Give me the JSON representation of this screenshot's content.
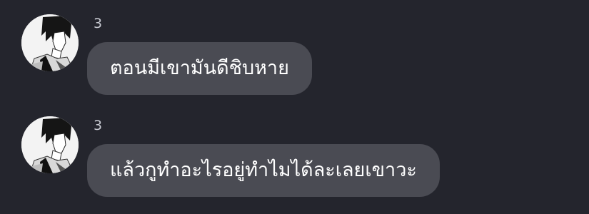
{
  "messages": [
    {
      "sender": "3",
      "text": "ตอนมีเขามันดีชิบหาย",
      "avatar_icon": "user-avatar-icon"
    },
    {
      "sender": "3",
      "text": "แล้วกูทำอะไรอยู่ทำไมได้ละเลยเขาวะ",
      "avatar_icon": "user-avatar-icon"
    }
  ],
  "colors": {
    "background": "#24252d",
    "bubble": "#4a4b53",
    "text": "#ffffff",
    "sender": "#c9cbd3"
  }
}
